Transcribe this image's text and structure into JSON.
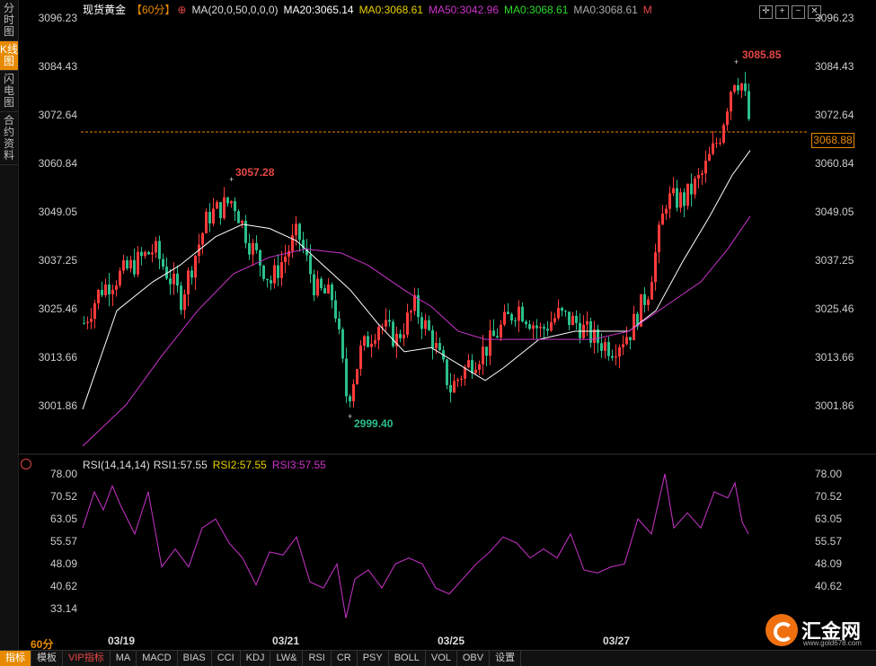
{
  "sidebar": [
    {
      "label": "分时图",
      "active": false
    },
    {
      "label": "K线图",
      "active": true
    },
    {
      "label": "闪电图",
      "active": false
    },
    {
      "label": "合约资料",
      "active": false
    }
  ],
  "header": {
    "instrument": "现货黄金",
    "period": "【60分】",
    "ma_params": "MA(20,0,50,0,0,0)",
    "ma20": "MA20:3065.14",
    "ma0a": "MA0:3068.61",
    "ma50": "MA50:3042.96",
    "ma0b": "MA0:3068.61",
    "ma0c": "MA0:3068.61",
    "mark": "M"
  },
  "colors": {
    "up": "#ff3b3b",
    "down": "#2bbf8a",
    "ma20": "#ffffff",
    "ma50": "#cc33cc",
    "accent": "#e88a00",
    "rsi": "#cc33cc"
  },
  "price_axis": {
    "ticks": [
      "3096.23",
      "3084.43",
      "3072.64",
      "3060.84",
      "3049.05",
      "3037.25",
      "3025.46",
      "3013.66",
      "3001.86"
    ]
  },
  "current_price": "3068.88",
  "annotations": {
    "high": "3085.85",
    "high2": "3057.28",
    "low": "2999.40"
  },
  "rsi": {
    "title": "RSI(14,14,14)",
    "rsi1": "RSI1:57.55",
    "rsi2": "RSI2:57.55",
    "rsi3": "RSI3:57.55",
    "ticks": [
      "78.00",
      "70.52",
      "63.05",
      "55.57",
      "48.09",
      "40.62",
      "33.14"
    ]
  },
  "x_labels": [
    "03/19",
    "03/21",
    "03/25",
    "03/27"
  ],
  "period_label": "60分",
  "bottom_tabs": [
    {
      "label": "指标",
      "active": true
    },
    {
      "label": "模板"
    },
    {
      "label": "VIP指标",
      "vip": true
    },
    {
      "label": "MA"
    },
    {
      "label": "MACD"
    },
    {
      "label": "BIAS"
    },
    {
      "label": "CCI"
    },
    {
      "label": "KDJ"
    },
    {
      "label": "LW&"
    },
    {
      "label": "RSI"
    },
    {
      "label": "CR"
    },
    {
      "label": "PSY"
    },
    {
      "label": "BOLL"
    },
    {
      "label": "VOL"
    },
    {
      "label": "OBV"
    },
    {
      "label": "设置"
    }
  ],
  "logo": {
    "name": "汇金网",
    "url": "www.gold678.com"
  }
}
